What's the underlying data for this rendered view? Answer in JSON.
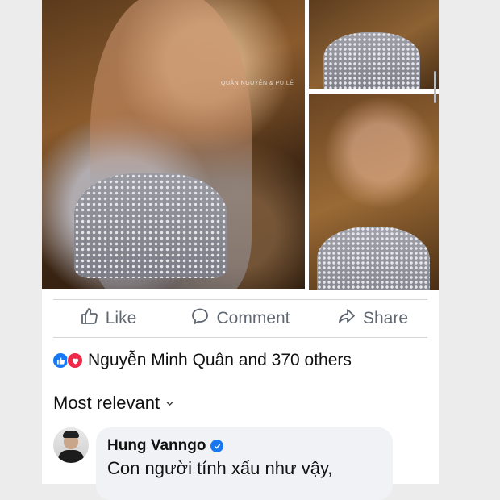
{
  "post": {
    "photo_caption": "QUÂN NGUYỄN & PU LÊ"
  },
  "actions": {
    "like_label": "Like",
    "comment_label": "Comment",
    "share_label": "Share"
  },
  "reactions": {
    "summary": "Nguyễn Minh Quân and 370 others",
    "icons": [
      "like-reaction-icon",
      "love-reaction-icon"
    ]
  },
  "comments": {
    "sort_label": "Most relevant",
    "items": [
      {
        "author": "Hung Vanngo",
        "verified": true,
        "text": "Con người tính xấu như vậy,"
      }
    ]
  },
  "colors": {
    "brand_blue": "#1877f2",
    "love_red": "#f0284a",
    "action_gray": "#606770",
    "bubble_bg": "#f0f2f5"
  }
}
